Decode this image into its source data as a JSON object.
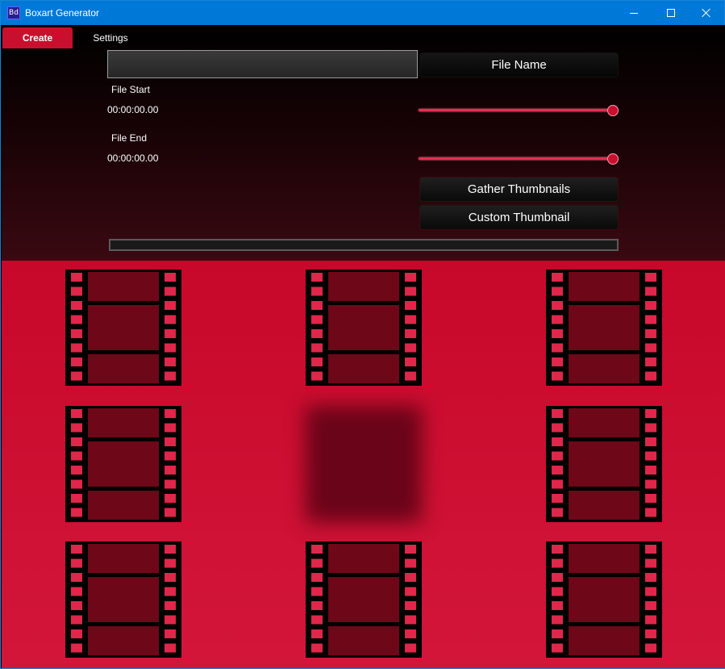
{
  "window": {
    "title": "Boxart Generator",
    "app_icon_text": "Bd",
    "accent": "#0078d7"
  },
  "tabs": [
    {
      "label": "Create",
      "active": true
    },
    {
      "label": "Settings",
      "active": false
    }
  ],
  "create": {
    "filename_input": {
      "value": "",
      "placeholder": ""
    },
    "filename_button": "File Name",
    "file_start": {
      "label": "File Start",
      "value": "00:00:00.00",
      "slider_fraction": 1.0
    },
    "file_end": {
      "label": "File End",
      "value": "00:00:00.00",
      "slider_fraction": 1.0
    },
    "gather_button": "Gather Thumbnails",
    "custom_button": "Custom Thumbnail",
    "progress_fraction": 0.0
  },
  "thumbnails": [
    {
      "icon": "film-strip-icon",
      "state": "placeholder"
    },
    {
      "icon": "film-strip-icon",
      "state": "placeholder"
    },
    {
      "icon": "film-strip-icon",
      "state": "placeholder"
    },
    {
      "icon": "film-strip-icon",
      "state": "placeholder"
    },
    {
      "icon": "blurred-thumbnail",
      "state": "loading"
    },
    {
      "icon": "film-strip-icon",
      "state": "placeholder"
    },
    {
      "icon": "film-strip-icon",
      "state": "placeholder"
    },
    {
      "icon": "film-strip-icon",
      "state": "placeholder"
    },
    {
      "icon": "film-strip-icon",
      "state": "placeholder"
    }
  ],
  "colors": {
    "brand_red": "#c8102e",
    "film_dark": "#6e0818",
    "film_hole": "#e0264a"
  }
}
